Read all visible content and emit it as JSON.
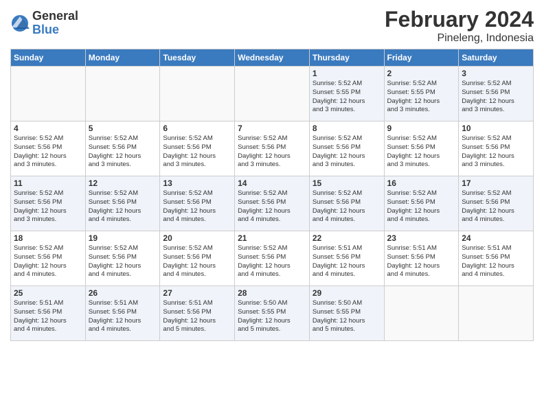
{
  "logo": {
    "general": "General",
    "blue": "Blue"
  },
  "title": "February 2024",
  "location": "Pineleng, Indonesia",
  "headers": [
    "Sunday",
    "Monday",
    "Tuesday",
    "Wednesday",
    "Thursday",
    "Friday",
    "Saturday"
  ],
  "weeks": [
    [
      {
        "day": "",
        "info": ""
      },
      {
        "day": "",
        "info": ""
      },
      {
        "day": "",
        "info": ""
      },
      {
        "day": "",
        "info": ""
      },
      {
        "day": "1",
        "info": "Sunrise: 5:52 AM\nSunset: 5:55 PM\nDaylight: 12 hours\nand 3 minutes."
      },
      {
        "day": "2",
        "info": "Sunrise: 5:52 AM\nSunset: 5:55 PM\nDaylight: 12 hours\nand 3 minutes."
      },
      {
        "day": "3",
        "info": "Sunrise: 5:52 AM\nSunset: 5:56 PM\nDaylight: 12 hours\nand 3 minutes."
      }
    ],
    [
      {
        "day": "4",
        "info": "Sunrise: 5:52 AM\nSunset: 5:56 PM\nDaylight: 12 hours\nand 3 minutes."
      },
      {
        "day": "5",
        "info": "Sunrise: 5:52 AM\nSunset: 5:56 PM\nDaylight: 12 hours\nand 3 minutes."
      },
      {
        "day": "6",
        "info": "Sunrise: 5:52 AM\nSunset: 5:56 PM\nDaylight: 12 hours\nand 3 minutes."
      },
      {
        "day": "7",
        "info": "Sunrise: 5:52 AM\nSunset: 5:56 PM\nDaylight: 12 hours\nand 3 minutes."
      },
      {
        "day": "8",
        "info": "Sunrise: 5:52 AM\nSunset: 5:56 PM\nDaylight: 12 hours\nand 3 minutes."
      },
      {
        "day": "9",
        "info": "Sunrise: 5:52 AM\nSunset: 5:56 PM\nDaylight: 12 hours\nand 3 minutes."
      },
      {
        "day": "10",
        "info": "Sunrise: 5:52 AM\nSunset: 5:56 PM\nDaylight: 12 hours\nand 3 minutes."
      }
    ],
    [
      {
        "day": "11",
        "info": "Sunrise: 5:52 AM\nSunset: 5:56 PM\nDaylight: 12 hours\nand 3 minutes."
      },
      {
        "day": "12",
        "info": "Sunrise: 5:52 AM\nSunset: 5:56 PM\nDaylight: 12 hours\nand 4 minutes."
      },
      {
        "day": "13",
        "info": "Sunrise: 5:52 AM\nSunset: 5:56 PM\nDaylight: 12 hours\nand 4 minutes."
      },
      {
        "day": "14",
        "info": "Sunrise: 5:52 AM\nSunset: 5:56 PM\nDaylight: 12 hours\nand 4 minutes."
      },
      {
        "day": "15",
        "info": "Sunrise: 5:52 AM\nSunset: 5:56 PM\nDaylight: 12 hours\nand 4 minutes."
      },
      {
        "day": "16",
        "info": "Sunrise: 5:52 AM\nSunset: 5:56 PM\nDaylight: 12 hours\nand 4 minutes."
      },
      {
        "day": "17",
        "info": "Sunrise: 5:52 AM\nSunset: 5:56 PM\nDaylight: 12 hours\nand 4 minutes."
      }
    ],
    [
      {
        "day": "18",
        "info": "Sunrise: 5:52 AM\nSunset: 5:56 PM\nDaylight: 12 hours\nand 4 minutes."
      },
      {
        "day": "19",
        "info": "Sunrise: 5:52 AM\nSunset: 5:56 PM\nDaylight: 12 hours\nand 4 minutes."
      },
      {
        "day": "20",
        "info": "Sunrise: 5:52 AM\nSunset: 5:56 PM\nDaylight: 12 hours\nand 4 minutes."
      },
      {
        "day": "21",
        "info": "Sunrise: 5:52 AM\nSunset: 5:56 PM\nDaylight: 12 hours\nand 4 minutes."
      },
      {
        "day": "22",
        "info": "Sunrise: 5:51 AM\nSunset: 5:56 PM\nDaylight: 12 hours\nand 4 minutes."
      },
      {
        "day": "23",
        "info": "Sunrise: 5:51 AM\nSunset: 5:56 PM\nDaylight: 12 hours\nand 4 minutes."
      },
      {
        "day": "24",
        "info": "Sunrise: 5:51 AM\nSunset: 5:56 PM\nDaylight: 12 hours\nand 4 minutes."
      }
    ],
    [
      {
        "day": "25",
        "info": "Sunrise: 5:51 AM\nSunset: 5:56 PM\nDaylight: 12 hours\nand 4 minutes."
      },
      {
        "day": "26",
        "info": "Sunrise: 5:51 AM\nSunset: 5:56 PM\nDaylight: 12 hours\nand 4 minutes."
      },
      {
        "day": "27",
        "info": "Sunrise: 5:51 AM\nSunset: 5:56 PM\nDaylight: 12 hours\nand 5 minutes."
      },
      {
        "day": "28",
        "info": "Sunrise: 5:50 AM\nSunset: 5:55 PM\nDaylight: 12 hours\nand 5 minutes."
      },
      {
        "day": "29",
        "info": "Sunrise: 5:50 AM\nSunset: 5:55 PM\nDaylight: 12 hours\nand 5 minutes."
      },
      {
        "day": "",
        "info": ""
      },
      {
        "day": "",
        "info": ""
      }
    ]
  ]
}
